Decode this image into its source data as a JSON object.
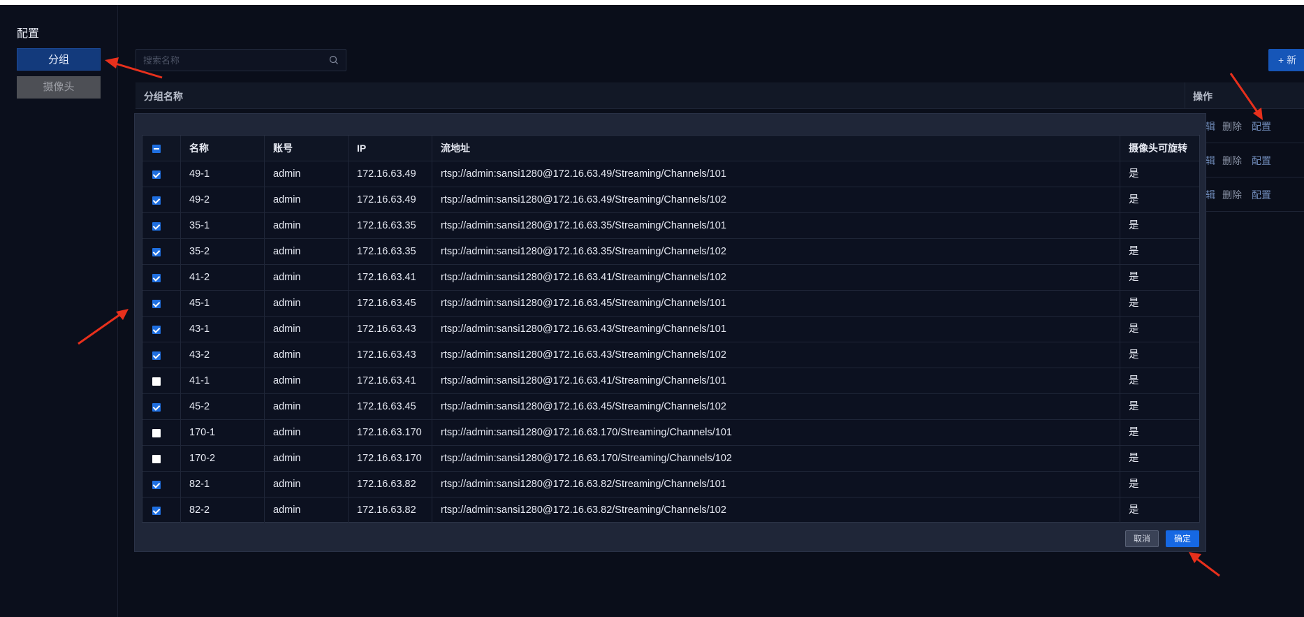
{
  "sidebar": {
    "title": "配置",
    "items": [
      {
        "label": "分组",
        "active": true
      },
      {
        "label": "摄像头",
        "active": false
      }
    ]
  },
  "search": {
    "placeholder": "搜索名称",
    "value": ""
  },
  "new_button": {
    "label": "+ 新"
  },
  "group_table": {
    "headers": {
      "name": "分组名称",
      "operations": "操作"
    },
    "rows": [
      {
        "edit": "辑",
        "delete": "删除",
        "config": "配置"
      },
      {
        "edit": "辑",
        "delete": "删除",
        "config": "配置"
      },
      {
        "edit": "辑",
        "delete": "删除",
        "config": "配置"
      }
    ]
  },
  "dialog": {
    "headers": {
      "checkbox_state": "partial",
      "name": "名称",
      "account": "账号",
      "ip": "IP",
      "stream": "流地址",
      "rotatable": "摄像头可旋转"
    },
    "rows": [
      {
        "checked": true,
        "name": "49-1",
        "account": "admin",
        "ip": "172.16.63.49",
        "stream": "rtsp://admin:sansi1280@172.16.63.49/Streaming/Channels/101",
        "rotatable": "是"
      },
      {
        "checked": true,
        "name": "49-2",
        "account": "admin",
        "ip": "172.16.63.49",
        "stream": "rtsp://admin:sansi1280@172.16.63.49/Streaming/Channels/102",
        "rotatable": "是"
      },
      {
        "checked": true,
        "name": "35-1",
        "account": "admin",
        "ip": "172.16.63.35",
        "stream": "rtsp://admin:sansi1280@172.16.63.35/Streaming/Channels/101",
        "rotatable": "是"
      },
      {
        "checked": true,
        "name": "35-2",
        "account": "admin",
        "ip": "172.16.63.35",
        "stream": "rtsp://admin:sansi1280@172.16.63.35/Streaming/Channels/102",
        "rotatable": "是"
      },
      {
        "checked": true,
        "name": "41-2",
        "account": "admin",
        "ip": "172.16.63.41",
        "stream": "rtsp://admin:sansi1280@172.16.63.41/Streaming/Channels/102",
        "rotatable": "是"
      },
      {
        "checked": true,
        "name": "45-1",
        "account": "admin",
        "ip": "172.16.63.45",
        "stream": "rtsp://admin:sansi1280@172.16.63.45/Streaming/Channels/101",
        "rotatable": "是"
      },
      {
        "checked": true,
        "name": "43-1",
        "account": "admin",
        "ip": "172.16.63.43",
        "stream": "rtsp://admin:sansi1280@172.16.63.43/Streaming/Channels/101",
        "rotatable": "是"
      },
      {
        "checked": true,
        "name": "43-2",
        "account": "admin",
        "ip": "172.16.63.43",
        "stream": "rtsp://admin:sansi1280@172.16.63.43/Streaming/Channels/102",
        "rotatable": "是"
      },
      {
        "checked": false,
        "name": "41-1",
        "account": "admin",
        "ip": "172.16.63.41",
        "stream": "rtsp://admin:sansi1280@172.16.63.41/Streaming/Channels/101",
        "rotatable": "是"
      },
      {
        "checked": true,
        "name": "45-2",
        "account": "admin",
        "ip": "172.16.63.45",
        "stream": "rtsp://admin:sansi1280@172.16.63.45/Streaming/Channels/102",
        "rotatable": "是"
      },
      {
        "checked": false,
        "name": "170-1",
        "account": "admin",
        "ip": "172.16.63.170",
        "stream": "rtsp://admin:sansi1280@172.16.63.170/Streaming/Channels/101",
        "rotatable": "是"
      },
      {
        "checked": false,
        "name": "170-2",
        "account": "admin",
        "ip": "172.16.63.170",
        "stream": "rtsp://admin:sansi1280@172.16.63.170/Streaming/Channels/102",
        "rotatable": "是"
      },
      {
        "checked": true,
        "name": "82-1",
        "account": "admin",
        "ip": "172.16.63.82",
        "stream": "rtsp://admin:sansi1280@172.16.63.82/Streaming/Channels/101",
        "rotatable": "是"
      },
      {
        "checked": true,
        "name": "82-2",
        "account": "admin",
        "ip": "172.16.63.82",
        "stream": "rtsp://admin:sansi1280@172.16.63.82/Streaming/Channels/102",
        "rotatable": "是"
      }
    ],
    "cancel_label": "取消",
    "ok_label": "确定"
  },
  "colors": {
    "accent": "#1668e3",
    "background": "#0a0e1a",
    "annotation_arrow": "#e8301c"
  }
}
